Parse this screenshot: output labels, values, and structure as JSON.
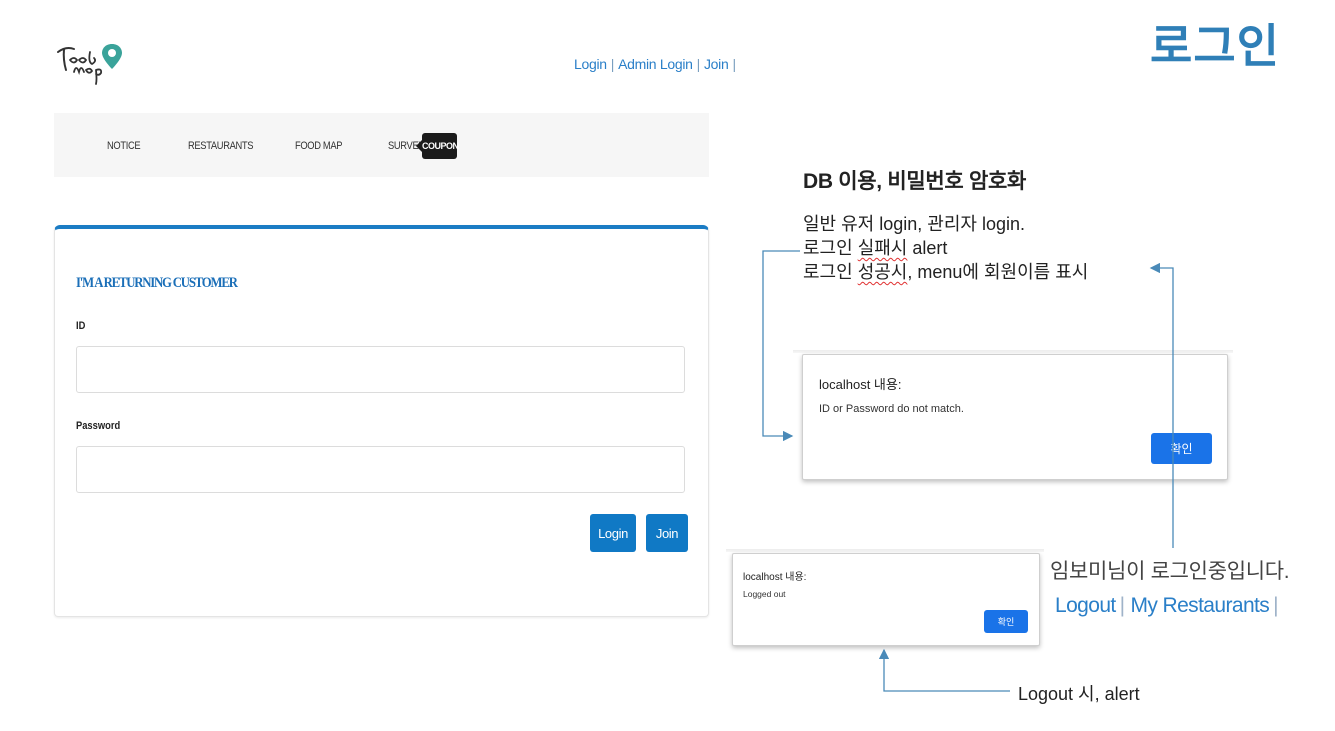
{
  "slide_title": "로그인",
  "site": {
    "logo_alt": "Food Map logo",
    "top_links": [
      "Login",
      "Admin Login",
      "Join"
    ],
    "nav_items": [
      "NOTICE",
      "RESTAURANTS",
      "FOOD MAP",
      "SURVEY"
    ],
    "coupon_badge": "COUPON",
    "login_form": {
      "title": "I'M A RETURNING CUSTOMER",
      "id_label": "ID",
      "id_value": "",
      "password_label": "Password",
      "password_value": "",
      "login_button": "Login",
      "join_button": "Join"
    }
  },
  "annotations": {
    "db_title": "DB 이용, 비밀번호 암호화",
    "line1": "일반 유저 login, 관리자 login.",
    "line2_a": "로그인 ",
    "line2_b": "실패시",
    "line2_c": " alert",
    "line3_a": "로그인 ",
    "line3_b": "성공시",
    "line3_c": ", menu에 회원이름 표시",
    "logout_note": "Logout 시, alert"
  },
  "alert_fail": {
    "title": "localhost 내용:",
    "message": "ID or Password do not match.",
    "ok_button": "확인"
  },
  "alert_logout": {
    "title": "localhost 내용:",
    "message": "Logged out",
    "ok_button": "확인"
  },
  "logged_in_menu": {
    "status": "임보미님이 로그인중입니다.",
    "logout_link": "Logout",
    "my_restaurants_link": "My Restaurants"
  },
  "colors": {
    "accent_blue": "#1b7cc4",
    "heading_blue": "#2f7fb7",
    "dialog_button": "#1a73e8",
    "arrow_line": "#4a8ab8"
  }
}
